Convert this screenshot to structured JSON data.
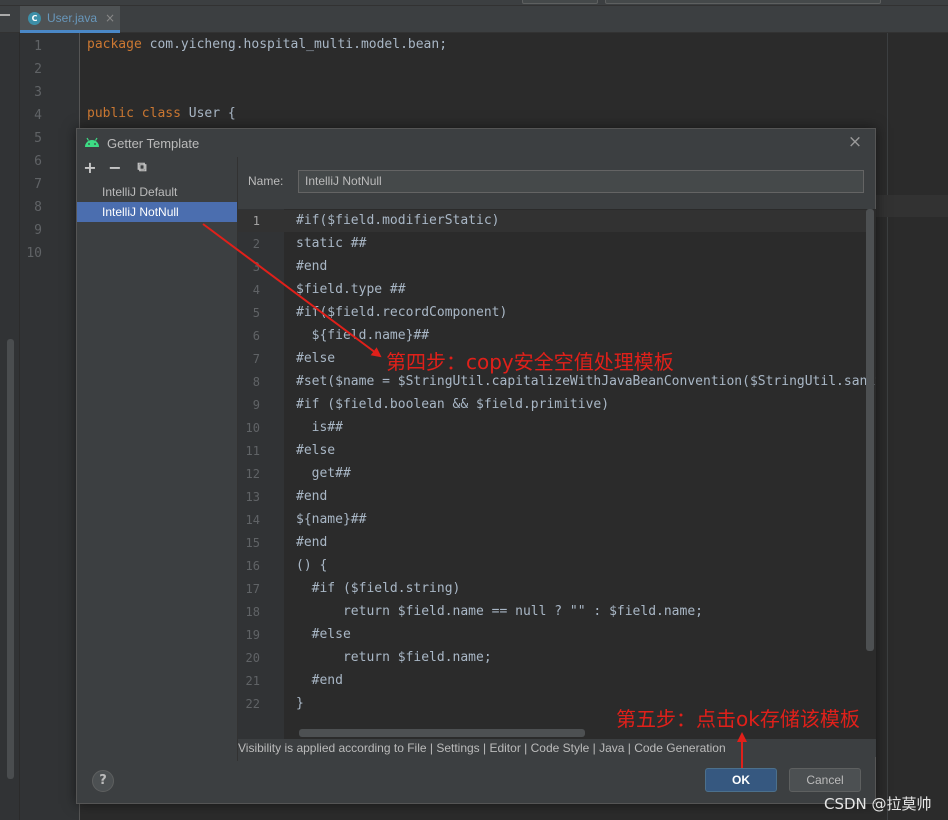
{
  "tab": {
    "filename": "User.java",
    "icon": "C",
    "close": "×"
  },
  "main_editor": {
    "line_numbers": [
      "1",
      "2",
      "3",
      "4",
      "5",
      "6",
      "7",
      "8",
      "9",
      "10"
    ],
    "line1": {
      "kw": "package",
      "rest": " com.yicheng.hospital_multi.model.bean;"
    },
    "line4": {
      "kw": "public class",
      "rest": " User {"
    }
  },
  "dialog": {
    "title": "Getter Template",
    "close": "×",
    "toolbar": {
      "add": "+",
      "remove": "−",
      "copy": "⧉"
    },
    "templates": [
      "IntelliJ Default",
      "IntelliJ NotNull"
    ],
    "name_label": "Name:",
    "name_value": "IntelliJ NotNull",
    "code_lines": [
      "#if($field.modifierStatic)",
      "static ##",
      "#end",
      "$field.type ##",
      "#if($field.recordComponent)",
      "  ${field.name}##",
      "#else",
      "#set($name = $StringUtil.capitalizeWithJavaBeanConvention($StringUtil.sanitizeJavaIdentifier($helper.getPropertyName($field, $project))))",
      "#if ($field.boolean && $field.primitive)",
      "  is##",
      "#else",
      "  get##",
      "#end",
      "${name}##",
      "#end",
      "() {",
      "  #if ($field.string)",
      "      return $field.name == null ? \"\" : $field.name;",
      "  #else",
      "      return $field.name;",
      "  #end",
      "}"
    ],
    "footnote": "Visibility is applied according to File | Settings | Editor | Code Style | Java | Code Generation",
    "help": "?",
    "ok": "OK",
    "cancel": "Cancel"
  },
  "annotations": {
    "step4": "第四步：copy安全空值处理模板",
    "step5": "第五步：点击ok存储该模板",
    "color": "#e0201a"
  },
  "watermark": "CSDN @拉莫帅"
}
